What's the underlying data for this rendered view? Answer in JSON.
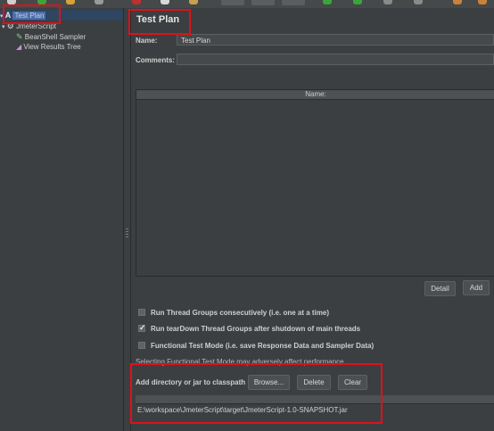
{
  "tree": {
    "items": [
      {
        "label": "Test Plan"
      },
      {
        "label": "JmeterScript"
      },
      {
        "label": "BeanShell Sampler"
      },
      {
        "label": "View Results Tree"
      }
    ]
  },
  "panel": {
    "title": "Test Plan",
    "name_label": "Name:",
    "name_value": "Test Plan",
    "comments_label": "Comments:",
    "comments_value": "",
    "table_header": "Name:",
    "detail_button": "Detail",
    "add_button": "Add",
    "options": [
      {
        "label": "Run Thread Groups consecutively (i.e. one at a time)",
        "checked": false
      },
      {
        "label": "Run tearDown Thread Groups after shutdown of main threads",
        "checked": true
      },
      {
        "label": "Functional Test Mode (i.e. save Response Data and Sampler Data)",
        "checked": false
      }
    ],
    "functional_note": "Selecting Functional Test Mode may adversely affect performance.",
    "classpath_label": "Add directory or jar to classpath",
    "browse_button": "Browse...",
    "delete_button": "Delete",
    "clear_button": "Clear",
    "classpath_items": [
      "E:\\workspace\\JmeterScript\\target\\JmeterScript-1.0-SNAPSHOT.jar"
    ]
  },
  "colors": {
    "background": "#3c3f41",
    "selection": "#4b6eaf",
    "highlight_box": "#e0101a"
  }
}
